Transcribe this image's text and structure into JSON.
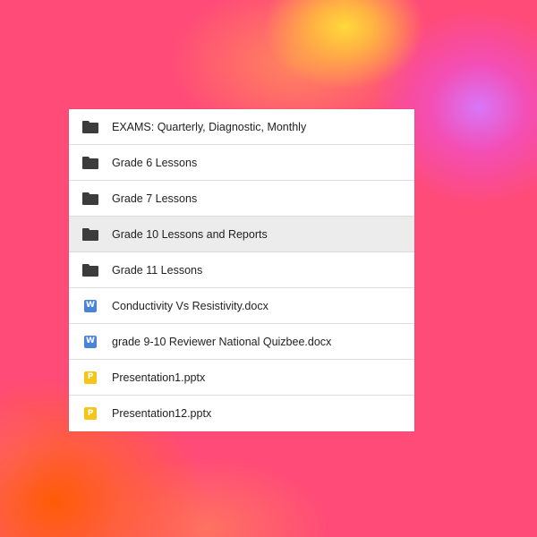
{
  "file_list": {
    "items": [
      {
        "name": "EXAMS: Quarterly, Diagnostic, Monthly",
        "type": "folder",
        "icon": "folder-icon",
        "selected": false
      },
      {
        "name": "Grade 6 Lessons",
        "type": "folder",
        "icon": "folder-icon",
        "selected": false
      },
      {
        "name": "Grade 7 Lessons",
        "type": "folder",
        "icon": "folder-icon",
        "selected": false
      },
      {
        "name": "Grade 10 Lessons and Reports",
        "type": "folder",
        "icon": "folder-icon",
        "selected": true
      },
      {
        "name": "Grade 11 Lessons",
        "type": "folder",
        "icon": "folder-icon",
        "selected": false
      },
      {
        "name": "Conductivity Vs Resistivity.docx",
        "type": "word",
        "icon": "word-document-icon",
        "badge": "W",
        "selected": false
      },
      {
        "name": "grade 9-10 Reviewer National Quizbee.docx",
        "type": "word",
        "icon": "word-document-icon",
        "badge": "W",
        "selected": false
      },
      {
        "name": "Presentation1.pptx",
        "type": "powerpoint",
        "icon": "powerpoint-document-icon",
        "badge": "P",
        "selected": false
      },
      {
        "name": "Presentation12.pptx",
        "type": "powerpoint",
        "icon": "powerpoint-document-icon",
        "badge": "P",
        "selected": false
      }
    ]
  },
  "colors": {
    "background": "#ff4b78",
    "folder": "#3c3c3c",
    "word": "#4a84d8",
    "powerpoint": "#f5c518",
    "selected_row": "#ececec"
  }
}
